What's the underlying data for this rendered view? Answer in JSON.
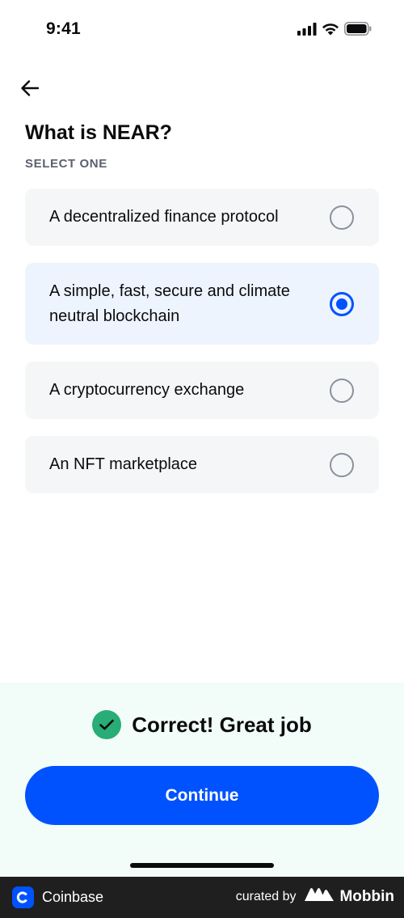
{
  "status_bar": {
    "time": "9:41"
  },
  "question": {
    "title": "What is NEAR?",
    "hint": "SELECT ONE"
  },
  "options": [
    {
      "label": "A decentralized finance protocol",
      "selected": false
    },
    {
      "label": "A simple, fast, secure and climate neutral blockchain",
      "selected": true
    },
    {
      "label": "A cryptocurrency exchange",
      "selected": false
    },
    {
      "label": "An NFT marketplace",
      "selected": false
    }
  ],
  "feedback": {
    "message": "Correct! Great job",
    "continue_label": "Continue"
  },
  "footer": {
    "app_name": "Coinbase",
    "curated_by": "curated by",
    "brand": "Mobbin"
  },
  "colors": {
    "accent": "#0052ff",
    "success": "#27ad75",
    "selected_bg": "#eef4fd",
    "option_bg": "#f5f6f7",
    "feedback_bg": "#f2fcf8"
  },
  "icons": {
    "back": "arrow-left-icon",
    "check": "check-icon",
    "signal": "cellular-signal-icon",
    "wifi": "wifi-icon",
    "battery": "battery-icon"
  }
}
